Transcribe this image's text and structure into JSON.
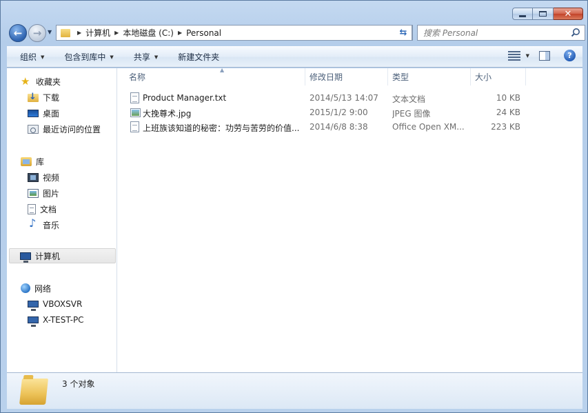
{
  "address": {
    "crumbs": [
      "计算机",
      "本地磁盘 (C:)",
      "Personal"
    ]
  },
  "search": {
    "placeholder": "搜索 Personal"
  },
  "toolbar": {
    "organize": "组织",
    "include_in_library": "包含到库中",
    "share": "共享",
    "new_folder": "新建文件夹"
  },
  "nav": {
    "favorites": "收藏夹",
    "downloads": "下载",
    "desktop": "桌面",
    "recent": "最近访问的位置",
    "libraries": "库",
    "videos": "视频",
    "pictures": "图片",
    "documents": "文档",
    "music": "音乐",
    "computer": "计算机",
    "network": "网络",
    "net_items": [
      "VBOXSVR",
      "X-TEST-PC"
    ]
  },
  "columns": {
    "name": "名称",
    "modified": "修改日期",
    "type": "类型",
    "size": "大小"
  },
  "files": [
    {
      "name": "Product Manager.txt",
      "modified": "2014/5/13 14:07",
      "type": "文本文档",
      "size": "10 KB",
      "icon": "text-file-icon"
    },
    {
      "name": "大挽尊术.jpg",
      "modified": "2015/1/2 9:00",
      "type": "JPEG 图像",
      "size": "24 KB",
      "icon": "image-file-icon"
    },
    {
      "name": "上班族该知道的秘密：功劳与苦劳的价值...",
      "modified": "2014/6/8 8:38",
      "type": "Office Open XM...",
      "size": "223 KB",
      "icon": "document-file-icon"
    }
  ],
  "status": {
    "count": "3 个对象"
  }
}
